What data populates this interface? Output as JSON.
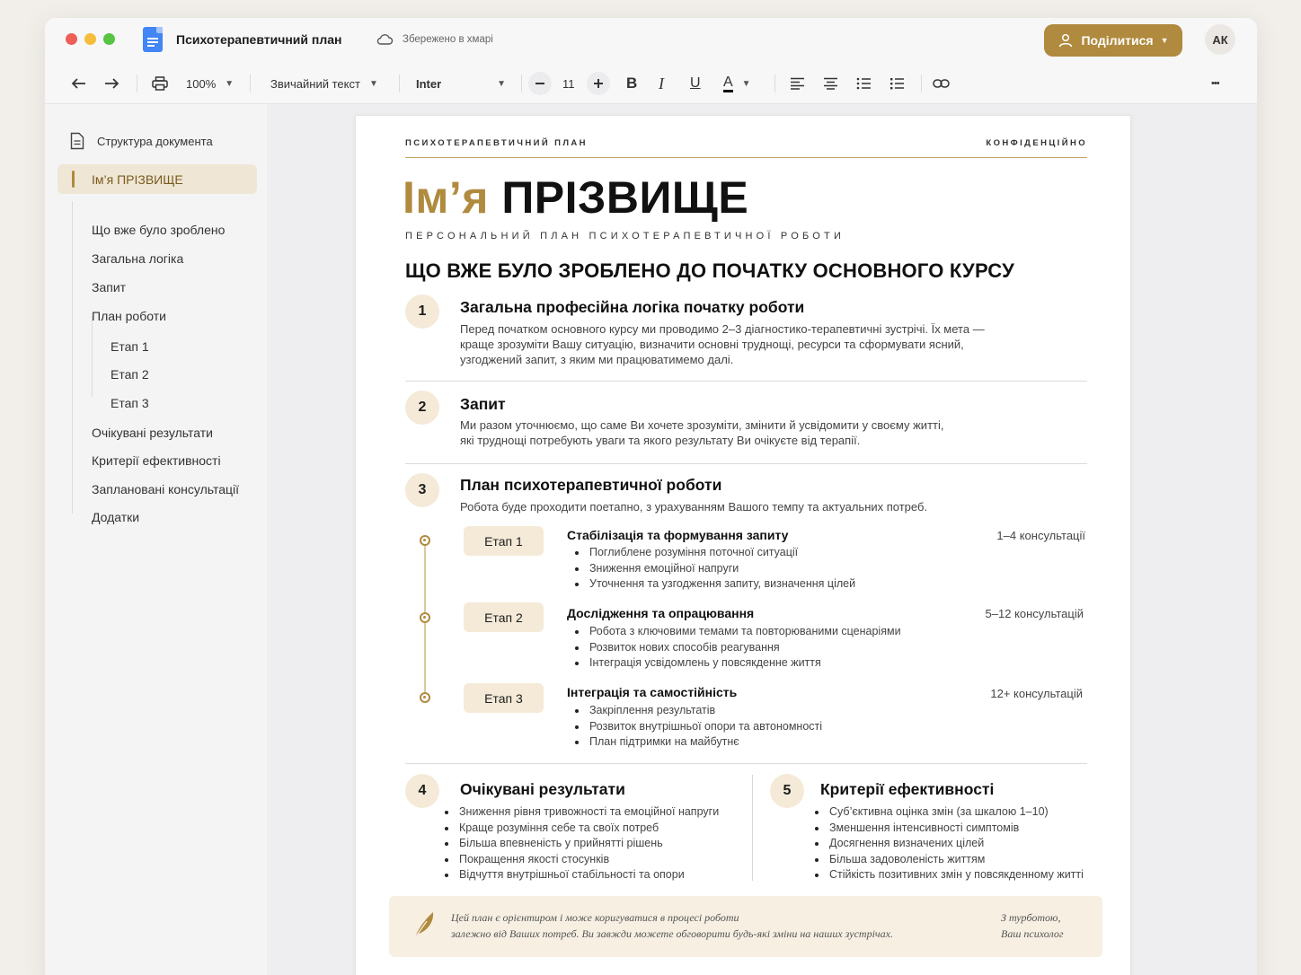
{
  "window": {
    "title": "Психотерапевтичний план",
    "save_status": "Збережено в хмарі",
    "share_label": "Поділитися",
    "avatar_initials": "АК"
  },
  "toolbar": {
    "zoom": "100%",
    "text_style": "Звичайний текст",
    "font": "Inter",
    "font_size": "11",
    "bold": "B",
    "italic": "I",
    "underline": "U",
    "text_color": "A",
    "more": "•••"
  },
  "sidebar": {
    "header": "Структура документа",
    "active": "Ім’я ПРІЗВИЩЕ",
    "items": [
      "Що вже було зроблено",
      "Загальна логіка",
      "Запит",
      "План роботи"
    ],
    "sub_items": [
      "Етап 1",
      "Етап 2",
      "Етап 3"
    ],
    "items_after": [
      "Очікувані результати",
      "Критерії ефективності",
      "Заплановані консультації",
      "Додатки"
    ]
  },
  "document": {
    "header_left": "ПСИХОТЕРАПЕВТИЧНИЙ ПЛАН",
    "header_right": "КОНФІДЕНЦІЙНО",
    "first_name": "Ім’я",
    "last_name": "ПРІЗВИЩЕ",
    "subtitle": "ПЕРСОНАЛЬНИЙ ПЛАН ПСИХОТЕРАПЕВТИЧНОЇ РОБОТИ",
    "main_heading": "ЩО ВЖЕ БУЛО ЗРОБЛЕНО ДО ПОЧАТКУ ОСНОВНОГО КУРСУ",
    "sections": [
      {
        "number": "1",
        "title": "Загальна професійна логіка початку роботи",
        "lines": [
          "Перед початком основного курсу ми проводимо 2–3 діагностико-терапевтичні зустрічі. Їх мета —",
          "краще зрозуміти Вашу ситуацію, визначити основні труднощі, ресурси та сформувати ясний,",
          "узгоджений запит, з яким ми працюватимемо далі."
        ]
      },
      {
        "number": "2",
        "title": "Запит",
        "lines": [
          "Ми разом уточнюємо, що саме Ви хочете зрозуміти, змінити й усвідомити у своєму житті,",
          "які труднощі потребують уваги та якого результату Ви очікуєте від терапії."
        ]
      },
      {
        "number": "3",
        "title": "План психотерапевтичної роботи",
        "lines": [
          "Робота буде проходити поетапно, з урахуванням Вашого темпу та актуальних потреб."
        ]
      }
    ],
    "stages": [
      {
        "tag": "Етап 1",
        "title": "Стабілізація та формування запиту",
        "count": "1–4 консультації",
        "bullets": [
          "Поглиблене розуміння поточної ситуації",
          "Зниження емоційної напруги",
          "Уточнення та узгодження запиту, визначення цілей"
        ]
      },
      {
        "tag": "Етап 2",
        "title": "Дослідження та опрацювання",
        "count": "5–12 консультацій",
        "bullets": [
          "Робота з ключовими темами та повторюваними сценаріями",
          "Розвиток нових способів реагування",
          "Інтеграція усвідомлень у повсякденне життя"
        ]
      },
      {
        "tag": "Етап 3",
        "title": "Інтеграція та самостійність",
        "count": "12+ консультацій",
        "bullets": [
          "Закріплення результатів",
          "Розвиток внутрішньої опори та автономності",
          "План підтримки на майбутнє"
        ]
      }
    ],
    "results": {
      "number": "4",
      "title": "Очікувані результати",
      "bullets": [
        "Зниження рівня тривожності та емоційної напруги",
        "Краще розуміння себе та своїх потреб",
        "Більша впевненість у прийнятті рішень",
        "Покращення якості стосунків",
        "Відчуття внутрішньої стабільності та опори"
      ]
    },
    "criteria": {
      "number": "5",
      "title": "Критерії ефективності",
      "bullets": [
        "Суб’єктивна оцінка змін (за шкалою 1–10)",
        "Зменшення інтенсивності симптомів",
        "Досягнення визначених цілей",
        "Більша задоволеність життям",
        "Стійкість позитивних змін у повсякденному житті"
      ]
    },
    "note": {
      "line1": "Цей план є орієнтиром і може коригуватися в процесі роботи",
      "line2": "залежно від Ваших потреб. Ви завжди можете обговорити будь-які зміни на наших зустрічах.",
      "sign1": "З турботою,",
      "sign2": "Ваш психолог"
    }
  },
  "colors": {
    "accent": "#b08a3e",
    "accent_light": "#f4ead7"
  }
}
